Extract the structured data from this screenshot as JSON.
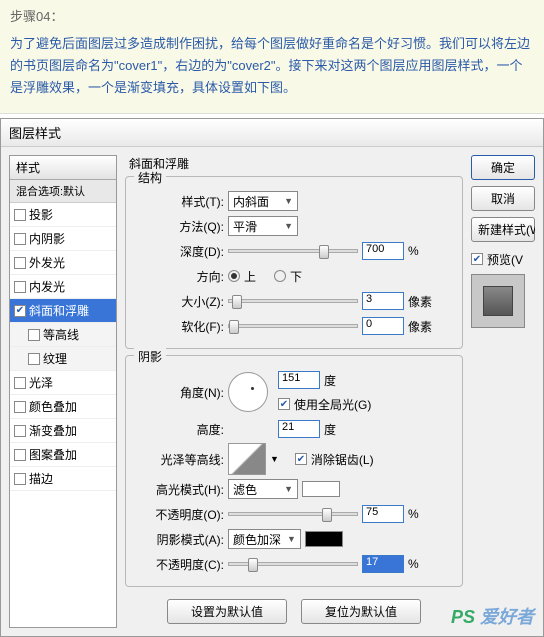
{
  "tutorial": {
    "step": "步骤04：",
    "text": "为了避免后面图层过多造成制作困扰，给每个图层做好重命名是个好习惯。我们可以将左边的书页图层命名为\"cover1\"，右边的为\"cover2\"。接下来对这两个图层应用图层样式，一个是浮雕效果，一个是渐变填充，具体设置如下图。"
  },
  "dialog": {
    "title": "图层样式"
  },
  "styles": {
    "header": "样式",
    "blend": "混合选项:默认",
    "items": [
      {
        "label": "投影",
        "checked": false
      },
      {
        "label": "内阴影",
        "checked": false
      },
      {
        "label": "外发光",
        "checked": false
      },
      {
        "label": "内发光",
        "checked": false
      },
      {
        "label": "斜面和浮雕",
        "checked": true,
        "selected": true
      },
      {
        "label": "等高线",
        "checked": false,
        "sub": true
      },
      {
        "label": "纹理",
        "checked": false,
        "sub": true
      },
      {
        "label": "光泽",
        "checked": false
      },
      {
        "label": "颜色叠加",
        "checked": false
      },
      {
        "label": "渐变叠加",
        "checked": false
      },
      {
        "label": "图案叠加",
        "checked": false
      },
      {
        "label": "描边",
        "checked": false
      }
    ]
  },
  "bevel": {
    "title": "斜面和浮雕",
    "structure_title": "结构",
    "style_label": "样式(T):",
    "style_value": "内斜面",
    "method_label": "方法(Q):",
    "method_value": "平滑",
    "depth_label": "深度(D):",
    "depth_value": "700",
    "depth_unit": "%",
    "direction_label": "方向:",
    "up": "上",
    "down": "下",
    "size_label": "大小(Z):",
    "size_value": "3",
    "size_unit": "像素",
    "soften_label": "软化(F):",
    "soften_value": "0",
    "soften_unit": "像素",
    "shadow_title": "阴影",
    "angle_label": "角度(N):",
    "angle_value": "151",
    "angle_unit": "度",
    "global_label": "使用全局光(G)",
    "altitude_label": "高度:",
    "altitude_value": "21",
    "altitude_unit": "度",
    "gloss_label": "光泽等高线:",
    "antialias_label": "消除锯齿(L)",
    "highlight_mode_label": "高光模式(H):",
    "highlight_mode_value": "滤色",
    "highlight_color": "#ffffff",
    "highlight_op_label": "不透明度(O):",
    "highlight_op_value": "75",
    "highlight_op_unit": "%",
    "shadow_mode_label": "阴影模式(A):",
    "shadow_mode_value": "颜色加深",
    "shadow_color": "#000000",
    "shadow_op_label": "不透明度(C):",
    "shadow_op_value": "17",
    "shadow_op_unit": "%",
    "default_btn": "设置为默认值",
    "reset_btn": "复位为默认值"
  },
  "buttons": {
    "ok": "确定",
    "cancel": "取消",
    "new_style": "新建样式(W",
    "preview": "预览(V"
  },
  "watermark": {
    "ps": "PS",
    "text": "爱好者"
  }
}
